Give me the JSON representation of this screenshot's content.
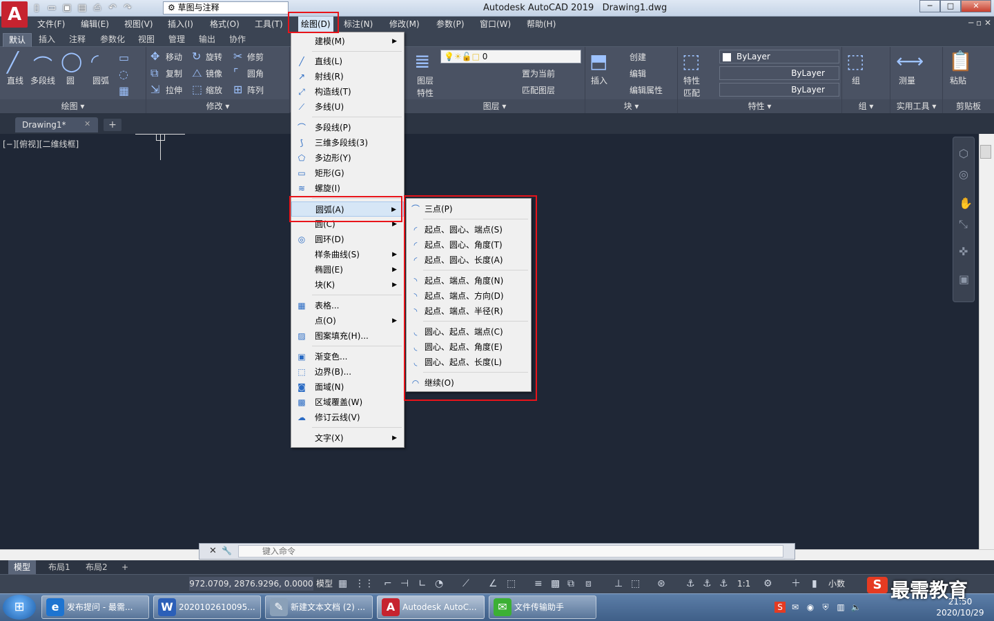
{
  "app": {
    "logo_letter": "A",
    "title": "Autodesk AutoCAD 2019",
    "drawing": "Drawing1.dwg",
    "workspace": "草图与注释"
  },
  "window_buttons": [
    "─",
    "□",
    "✕"
  ],
  "menubar": [
    "文件(F)",
    "编辑(E)",
    "视图(V)",
    "插入(I)",
    "格式(O)",
    "工具(T)",
    "绘图(D)",
    "标注(N)",
    "修改(M)",
    "参数(P)",
    "窗口(W)",
    "帮助(H)"
  ],
  "mdi_controls": "─ ▫ ✕",
  "ribbon_tabs": [
    "默认",
    "插入",
    "注释",
    "参数化",
    "视图",
    "管理",
    "输出",
    "协作"
  ],
  "ribbon": {
    "draw": {
      "line": "直线",
      "polyline": "多段线",
      "circle": "圆",
      "arc": "圆弧",
      "title": "绘图 ▾"
    },
    "modify": {
      "move": "移动",
      "rotate": "旋转",
      "trim": "修剪",
      "copy": "复制",
      "mirror": "镜像",
      "fillet": "圆角",
      "stretch": "拉伸",
      "scale": "缩放",
      "array": "阵列",
      "title": "修改 ▾"
    },
    "layers": {
      "layer_props": "图层",
      "layer_props2": "特性",
      "layer_value": "0",
      "set_current": "置为当前",
      "match_layer": "匹配图层",
      "title": "图层 ▾"
    },
    "block": {
      "insert": "插入",
      "create": "创建",
      "edit": "编辑",
      "edit_attr": "编辑属性",
      "title": "块 ▾"
    },
    "properties": {
      "match": "特性",
      "match2": "匹配",
      "color": "ByLayer",
      "linetype": "ByLayer",
      "lineweight": "ByLayer",
      "title": "特性 ▾"
    },
    "group": {
      "label": "组",
      "title": "组 ▾"
    },
    "utilities": {
      "measure": "测量",
      "title": "实用工具 ▾"
    },
    "clipboard": {
      "paste": "粘贴",
      "title": "剪贴板"
    }
  },
  "doc_tab": {
    "name": "Drawing1*",
    "close": "✕",
    "add": "+"
  },
  "viewport_label": "[−][俯视][二维线框]",
  "draw_menu": [
    {
      "label": "建模(M)",
      "sub": true,
      "icon": ""
    },
    {
      "label": "直线(L)",
      "icon": "╱"
    },
    {
      "label": "射线(R)",
      "icon": "↗"
    },
    {
      "label": "构造线(T)",
      "icon": "⤢"
    },
    {
      "label": "多线(U)",
      "icon": "⟋"
    },
    {
      "label": "多段线(P)",
      "icon": "⌒"
    },
    {
      "label": "三维多段线(3)",
      "icon": "⟆"
    },
    {
      "label": "多边形(Y)",
      "icon": "⬠"
    },
    {
      "label": "矩形(G)",
      "icon": "▭"
    },
    {
      "label": "螺旋(I)",
      "icon": "≋"
    },
    {
      "label": "圆弧(A)",
      "sub": true,
      "icon": ""
    },
    {
      "label": "圆(C)",
      "sub": true,
      "icon": ""
    },
    {
      "label": "圆环(D)",
      "icon": "◎"
    },
    {
      "label": "样条曲线(S)",
      "sub": true,
      "icon": ""
    },
    {
      "label": "椭圆(E)",
      "sub": true,
      "icon": ""
    },
    {
      "label": "块(K)",
      "sub": true,
      "icon": ""
    },
    {
      "label": "表格...",
      "icon": "▦"
    },
    {
      "label": "点(O)",
      "sub": true,
      "icon": ""
    },
    {
      "label": "图案填充(H)...",
      "icon": "▨"
    },
    {
      "label": "渐变色...",
      "icon": "▣"
    },
    {
      "label": "边界(B)...",
      "icon": "⬚"
    },
    {
      "label": "面域(N)",
      "icon": "◙"
    },
    {
      "label": "区域覆盖(W)",
      "icon": "▩"
    },
    {
      "label": "修订云线(V)",
      "icon": "☁"
    },
    {
      "label": "文字(X)",
      "sub": true,
      "icon": ""
    }
  ],
  "arc_menu": [
    {
      "label": "三点(P)",
      "icon": "⌒"
    },
    {
      "label": "起点、圆心、端点(S)",
      "icon": "◜"
    },
    {
      "label": "起点、圆心、角度(T)",
      "icon": "◜"
    },
    {
      "label": "起点、圆心、长度(A)",
      "icon": "◜"
    },
    {
      "label": "起点、端点、角度(N)",
      "icon": "◝"
    },
    {
      "label": "起点、端点、方向(D)",
      "icon": "◝"
    },
    {
      "label": "起点、端点、半径(R)",
      "icon": "◝"
    },
    {
      "label": "圆心、起点、端点(C)",
      "icon": "◟"
    },
    {
      "label": "圆心、起点、角度(E)",
      "icon": "◟"
    },
    {
      "label": "圆心、起点、长度(L)",
      "icon": "◟"
    },
    {
      "label": "继续(O)",
      "icon": "◠"
    }
  ],
  "command_line": {
    "placeholder": "键入命令"
  },
  "layout_tabs": [
    "模型",
    "布局1",
    "布局2",
    "+"
  ],
  "status": {
    "coords": "972.0709, 2876.9296, 0.0000",
    "model": "模型",
    "scale": "1:1",
    "units": "小数"
  },
  "watermark": "最需教育",
  "watermark_logo": "S",
  "taskbar": [
    {
      "label": "发布提问 - 最需...",
      "icon": "e",
      "color": "#1e74d0"
    },
    {
      "label": "2020102610095...",
      "icon": "W",
      "color": "#2b5fb8"
    },
    {
      "label": "新建文本文档 (2) ...",
      "icon": "✎",
      "color": "#8aa0b8"
    },
    {
      "label": "Autodesk AutoC...",
      "icon": "A",
      "color": "#c6232f"
    },
    {
      "label": "文件传输助手",
      "icon": "✉",
      "color": "#3cb034"
    }
  ],
  "clock": {
    "time": "21:50",
    "date": "2020/10/29"
  },
  "colors": {
    "accent_red": "#e8141a",
    "canvas": "#1f2736",
    "ribbon": "#4a5263"
  }
}
